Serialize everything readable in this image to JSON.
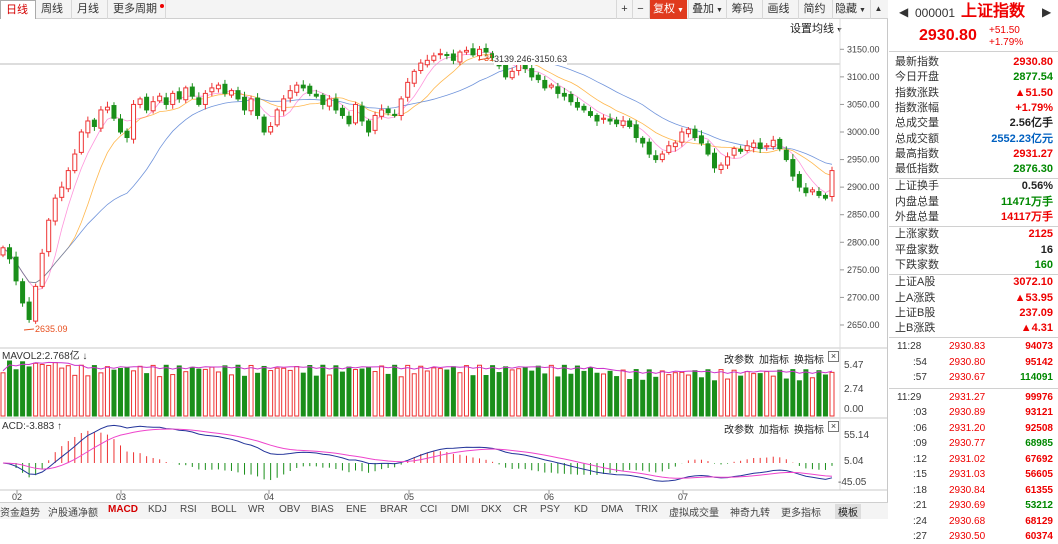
{
  "toolbar": {
    "tabs": [
      "日线",
      "周线",
      "月线",
      "更多周期"
    ],
    "active_tab": 0,
    "buttons": {
      "plus": "+",
      "minus": "−",
      "restore": "复权",
      "overlay": "叠加",
      "chips": "筹码",
      "draw": "画线",
      "simple": "简约",
      "hide": "隐藏"
    },
    "scroll_up": "▲"
  },
  "main_chart": {
    "set_ma": "设置均线",
    "high_annotation": "3150.63",
    "high_dates": "3139.246-3150.63",
    "low_annotation": "2635.09",
    "y_ticks": [
      "3150.00",
      "3100.00",
      "3050.00",
      "3000.00",
      "2950.00",
      "2900.00",
      "2850.00",
      "2800.00",
      "2750.00",
      "2700.00",
      "2650.00"
    ],
    "y_min": 2630,
    "y_max": 3185
  },
  "volume_panel": {
    "label": "MAVOL2:2.768亿",
    "arrow": "↓",
    "buttons": [
      "改参数",
      "加指标",
      "换指标"
    ],
    "close": "×",
    "y_ticks": [
      "5.47",
      "2.74",
      "0.00"
    ]
  },
  "macd_panel": {
    "label": "ACD:-3.883",
    "arrow": "↑",
    "buttons": [
      "改参数",
      "加指标",
      "换指标"
    ],
    "close": "×",
    "y_ticks": [
      "55.14",
      "5.04",
      "-45.05"
    ]
  },
  "x_axis": {
    "months": [
      "02",
      "03",
      "04",
      "05",
      "06",
      "07"
    ]
  },
  "indicator_tabs": [
    "资金趋势",
    "沪股通净额",
    "MACD",
    "KDJ",
    "RSI",
    "BOLL",
    "WR",
    "OBV",
    "BIAS",
    "ENE",
    "BRAR",
    "CCI",
    "DMI",
    "DKX",
    "CR",
    "PSY",
    "KD",
    "DMA",
    "TRIX",
    "虚拟成交量",
    "神奇九转",
    "更多指标",
    "模板"
  ],
  "active_indicator": "MACD",
  "quote": {
    "code": "000001",
    "name": "上证指数",
    "price": "2930.80",
    "change": "+51.50",
    "change_pct": "+1.79%",
    "rows1": [
      {
        "k": "最新指数",
        "v": "2930.80",
        "c": "red"
      },
      {
        "k": "今日开盘",
        "v": "2877.54",
        "c": "grn"
      },
      {
        "k": "指数涨跌",
        "v": "▲51.50",
        "c": "red"
      },
      {
        "k": "指数涨幅",
        "v": "+1.79%",
        "c": "red"
      },
      {
        "k": "总成交量",
        "v": "2.56亿手",
        "c": "blk"
      },
      {
        "k": "总成交额",
        "v": "2552.23亿元",
        "c": "blu"
      },
      {
        "k": "最高指数",
        "v": "2931.27",
        "c": "red"
      },
      {
        "k": "最低指数",
        "v": "2876.30",
        "c": "grn"
      }
    ],
    "rows2": [
      {
        "k": "上证换手",
        "v": "0.56%",
        "c": "blk"
      },
      {
        "k": "内盘总量",
        "v": "11471万手",
        "c": "grn"
      },
      {
        "k": "外盘总量",
        "v": "14117万手",
        "c": "red"
      }
    ],
    "rows3": [
      {
        "k": "上涨家数",
        "v": "2125",
        "c": "red"
      },
      {
        "k": "平盘家数",
        "v": "16",
        "c": "blk"
      },
      {
        "k": "下跌家数",
        "v": "160",
        "c": "grn"
      }
    ],
    "rows4": [
      {
        "k": "上证A股",
        "v": "3072.10",
        "c": "red"
      },
      {
        "k": "上A涨跌",
        "v": "▲53.95",
        "c": "red"
      },
      {
        "k": "上证B股",
        "v": "237.09",
        "c": "red"
      },
      {
        "k": "上B涨跌",
        "v": "▲4.31",
        "c": "red"
      }
    ]
  },
  "ticks": [
    {
      "t": "11:28",
      "p": "2930.83",
      "v": "94073"
    },
    {
      "t": ":54",
      "p": "2930.80",
      "v": "95142"
    },
    {
      "t": ":57",
      "p": "2930.67",
      "v": "114091"
    },
    {
      "t": "11:29",
      "p": "2931.27",
      "v": "99976"
    },
    {
      "t": ":03",
      "p": "2930.89",
      "v": "93121"
    },
    {
      "t": ":06",
      "p": "2931.20",
      "v": "92508"
    },
    {
      "t": ":09",
      "p": "2930.77",
      "v": "68985"
    },
    {
      "t": ":12",
      "p": "2931.02",
      "v": "67692"
    },
    {
      "t": ":15",
      "p": "2931.03",
      "v": "56605"
    },
    {
      "t": ":18",
      "p": "2930.84",
      "v": "61355"
    },
    {
      "t": ":21",
      "p": "2930.69",
      "v": "53212"
    },
    {
      "t": ":24",
      "p": "2930.68",
      "v": "68129"
    },
    {
      "t": ":27",
      "p": "2930.50",
      "v": "60374"
    }
  ],
  "chart_data": {
    "type": "candlestick",
    "closes": [
      2790,
      2770,
      2730,
      2690,
      2660,
      2720,
      2780,
      2840,
      2880,
      2900,
      2930,
      2960,
      3000,
      3020,
      3010,
      3040,
      3045,
      3025,
      3000,
      2990,
      3050,
      3060,
      3040,
      3055,
      3065,
      3050,
      3070,
      3060,
      3080,
      3065,
      3050,
      3070,
      3080,
      3085,
      3070,
      3075,
      3060,
      3040,
      3060,
      3030,
      3000,
      3010,
      3040,
      3060,
      3075,
      3085,
      3080,
      3070,
      3065,
      3050,
      3060,
      3040,
      3030,
      3015,
      3050,
      3020,
      3000,
      3030,
      3040,
      3035,
      3030,
      3060,
      3090,
      3110,
      3125,
      3130,
      3138,
      3142,
      3140,
      3130,
      3145,
      3148,
      3140,
      3150,
      3145,
      3135,
      3120,
      3100,
      3110,
      3125,
      3115,
      3100,
      3095,
      3080,
      3085,
      3070,
      3065,
      3055,
      3045,
      3040,
      3030,
      3020,
      3025,
      3020,
      3015,
      3020,
      3010,
      2990,
      2980,
      2960,
      2950,
      2960,
      2975,
      2980,
      3000,
      3005,
      2990,
      2980,
      2960,
      2935,
      2940,
      2955,
      2970,
      2965,
      2975,
      2980,
      2970,
      2975,
      2985,
      2970,
      2950,
      2920,
      2900,
      2890,
      2895,
      2885,
      2880,
      2930
    ]
  }
}
